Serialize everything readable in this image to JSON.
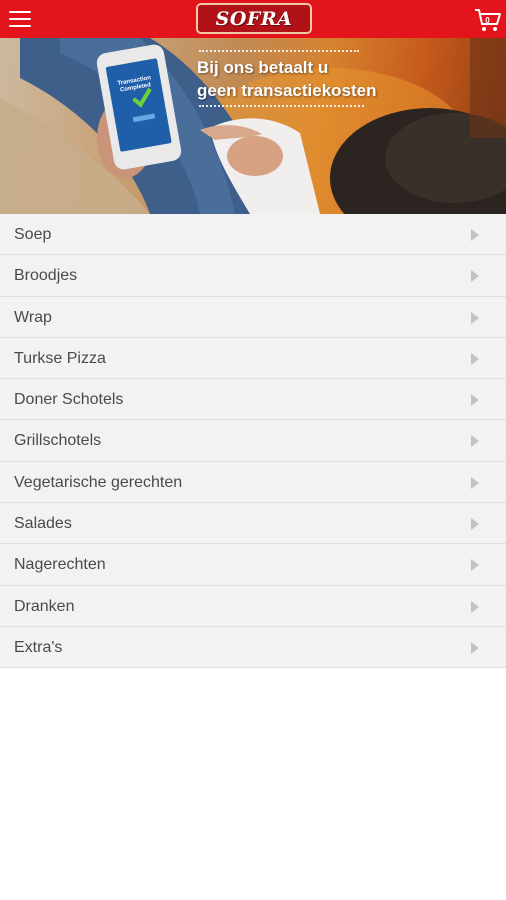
{
  "header": {
    "menu_icon": "hamburger-icon",
    "logo_text": "SOFRA",
    "cart_icon": "shopping-cart-icon",
    "cart_count": "0",
    "background_color": "#e3141b"
  },
  "banner": {
    "line1": "Bij ons betaalt u",
    "line2": "geen transactiekosten",
    "phone_screen_text": "Transaction Completed",
    "phone_check_icon": "check-icon"
  },
  "menu": {
    "items": [
      {
        "label": "Soep"
      },
      {
        "label": "Broodjes"
      },
      {
        "label": "Wrap"
      },
      {
        "label": "Turkse Pizza"
      },
      {
        "label": "Doner Schotels"
      },
      {
        "label": "Grillschotels"
      },
      {
        "label": "Vegetarische gerechten"
      },
      {
        "label": "Salades"
      },
      {
        "label": "Nagerechten"
      },
      {
        "label": "Dranken"
      },
      {
        "label": "Extra's"
      }
    ],
    "arrow_icon": "chevron-right-icon"
  }
}
